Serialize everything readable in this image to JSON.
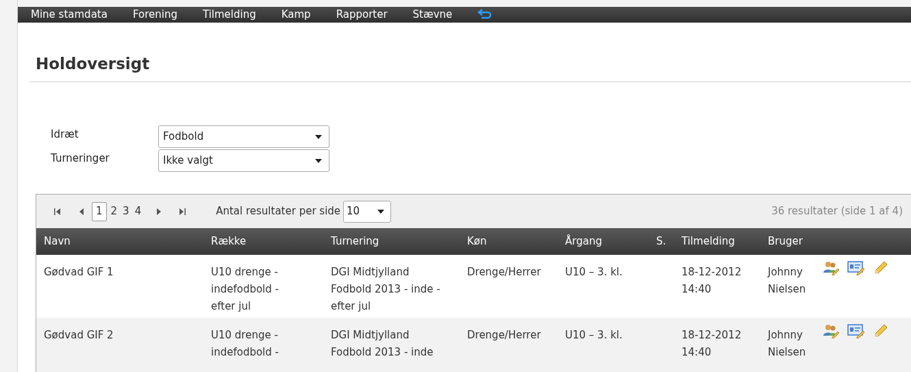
{
  "nav": {
    "items": [
      "Mine stamdata",
      "Forening",
      "Tilmelding",
      "Kamp",
      "Rapporter",
      "Stævne"
    ]
  },
  "page": {
    "title": "Holdoversigt"
  },
  "filters": [
    {
      "label": "Idræt",
      "value": "Fodbold"
    },
    {
      "label": "Turneringer",
      "value": "Ikke valgt"
    }
  ],
  "pager": {
    "pages": [
      {
        "label": "1",
        "selected": true
      },
      {
        "label": "2",
        "selected": false
      },
      {
        "label": "3",
        "selected": false
      },
      {
        "label": "4",
        "selected": false
      }
    ],
    "page_size_label": "Antal resultater per side",
    "page_size": "10",
    "summary": "36 resultater (side 1 af 4)"
  },
  "table": {
    "columns": [
      "Navn",
      "Række",
      "Turnering",
      "Køn",
      "Årgang",
      "S.",
      "Tilmelding",
      "Bruger"
    ],
    "rows": [
      {
        "cells": [
          "Gødvad GIF 1",
          "U10 drenge - indefodbold - efter jul",
          "DGI Midtjylland Fodbold 2013 - inde - efter jul",
          "Drenge/Herrer",
          "U10 – 3. kl.",
          "",
          "18-12-2012 14:40",
          "Johnny Nielsen"
        ]
      },
      {
        "cells": [
          "Gødvad GIF 2",
          "U10 drenge - indefodbold -",
          "DGI Midtjylland Fodbold 2013 - inde",
          "Drenge/Herrer",
          "U10 – 3. kl.",
          "",
          "18-12-2012 14:40",
          "Johnny Nielsen"
        ]
      }
    ]
  }
}
